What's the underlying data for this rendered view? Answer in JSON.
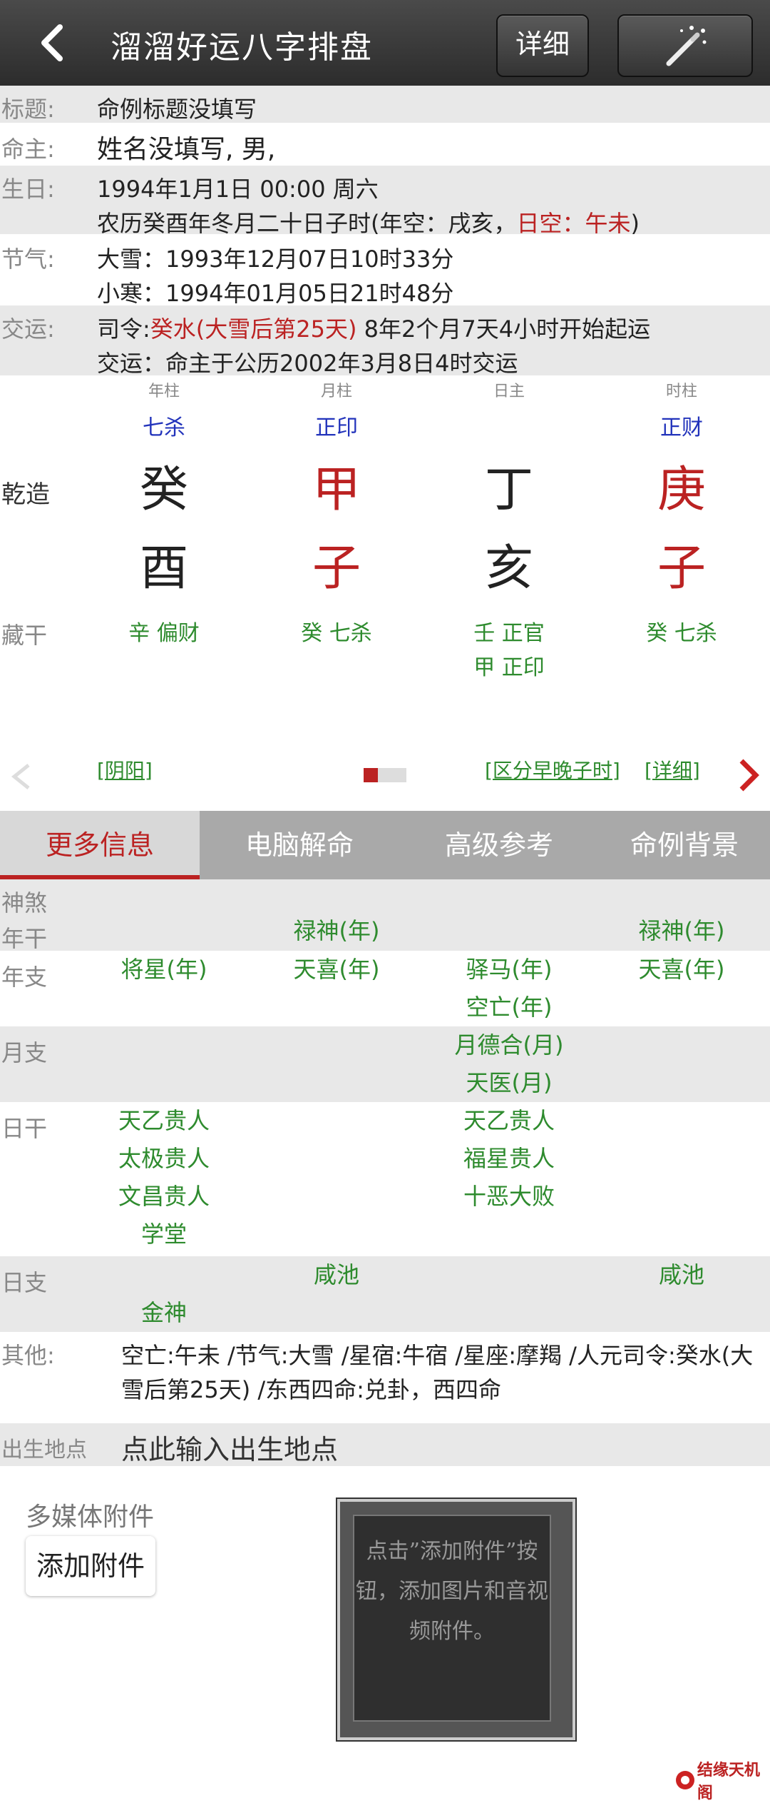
{
  "header": {
    "title": "溜溜好运八字排盘",
    "detail_label": "详细"
  },
  "info": {
    "title_label": "标题:",
    "title_value": "命例标题没填写",
    "owner_label": "命主:",
    "owner_value": "姓名没填写, 男,",
    "birth_label": "生日:",
    "birth_line1": "1994年1月1日 00:00 周六",
    "birth_line2_a": "农历癸酉年冬月二十日子时(年空：戌亥，",
    "birth_line2_b": "日空：午未",
    "birth_line2_c": ")",
    "jieqi_label": "节气:",
    "jieqi_line1": "大雪：1993年12月07日10时33分",
    "jieqi_line2": "小寒：1994年01月05日21时48分",
    "jiaoyun_label": "交运:",
    "jiaoyun_line1_a": "司令:",
    "jiaoyun_line1_b": "癸水(大雪后第25天)",
    "jiaoyun_line1_c": " 8年2个月7天4小时开始起运",
    "jiaoyun_line2": "交运：命主于公历2002年3月8日4时交运"
  },
  "pillars": {
    "row_label": "乾造",
    "canggan_label": "藏干",
    "cols": [
      {
        "header": "年柱",
        "god": "七杀",
        "stem": "癸",
        "branch": "酉",
        "hidden": [
          "辛 偏财"
        ]
      },
      {
        "header": "月柱",
        "god": "正印",
        "stem": "甲",
        "branch": "子",
        "hidden": [
          "癸 七杀"
        ]
      },
      {
        "header": "日主",
        "god": "",
        "stem": "丁",
        "branch": "亥",
        "hidden": [
          "壬 正官",
          "甲 正印"
        ]
      },
      {
        "header": "时柱",
        "god": "正财",
        "stem": "庚",
        "branch": "子",
        "hidden": [
          "癸 七杀"
        ]
      }
    ],
    "links": {
      "yinyang": "[阴阳]",
      "zishi": "[区分早晚子时]",
      "detail": "[详细]"
    }
  },
  "tabs": [
    "更多信息",
    "电脑解命",
    "高级参考",
    "命例背景"
  ],
  "shensha": {
    "title": "神煞",
    "niangan_label": "年干",
    "niangan": [
      "",
      "禄神(年)",
      "",
      "禄神(年)"
    ],
    "nianzhi_label": "年支",
    "nianzhi": [
      "将星(年)",
      "天喜(年)",
      "驿马(年)",
      "天喜(年)"
    ],
    "nianzhi_extra": "空亡(年)",
    "yuezhi_label": "月支",
    "yuezhi": [
      "月德合(月)",
      "天医(月)"
    ],
    "rigan_label": "日干",
    "rigan_col1": [
      "天乙贵人",
      "太极贵人",
      "文昌贵人",
      "学堂"
    ],
    "rigan_col3": [
      "天乙贵人",
      "福星贵人",
      "十恶大败"
    ],
    "rizhi_label": "日支",
    "rizhi_col2": "咸池",
    "rizhi_col4": "咸池",
    "rizhi_col1": "金神",
    "other_label": "其他:",
    "other_line1": "空亡:午未 /节气:大雪 /星宿:牛宿 /星座:摩羯 /人元司令:癸水(大",
    "other_line2": "雪后第25天) /东西四命:兑卦，西四命"
  },
  "birthplace": {
    "label": "出生地点",
    "value": "点此输入出生地点"
  },
  "media": {
    "label": "多媒体附件",
    "add_button": "添加附件",
    "note": "点击”添加附件”按钮，添加图片和音视频附件。"
  },
  "watermark": "结缘天机阁"
}
